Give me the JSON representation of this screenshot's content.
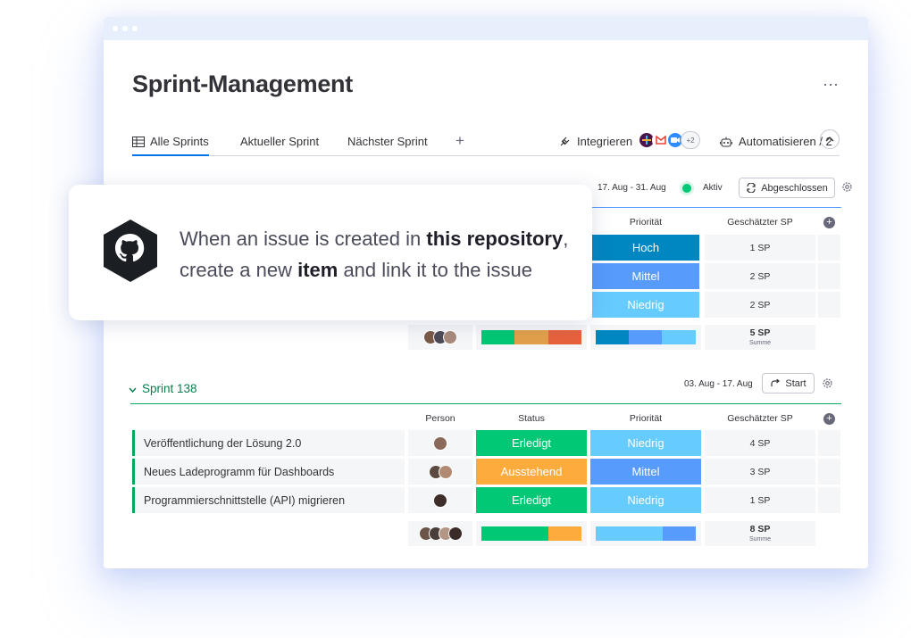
{
  "app": {
    "title": "Sprint-Management",
    "more_label": "⋯"
  },
  "tabs": [
    {
      "label": "Alle Sprints"
    },
    {
      "label": "Aktueller Sprint"
    },
    {
      "label": "Nächster Sprint"
    }
  ],
  "toolbar": {
    "add_tab": "+",
    "integrate_label": "Integrieren",
    "apps_more": "+2",
    "automate_label": "Automatisieren / 2"
  },
  "columns": {
    "person": "Person",
    "status": "Status",
    "priority": "Priorität",
    "estimate": "Geschätzter SP"
  },
  "group1": {
    "dates": "17. Aug - 31. Aug",
    "state": "Aktiv",
    "action": "Abgeschlossen",
    "rows": [
      {
        "priority": "Hoch",
        "priority_color": "#0086c0",
        "sp": "1 SP"
      },
      {
        "priority": "Mittel",
        "priority_color": "#579bfc",
        "sp": "2 SP"
      },
      {
        "priority": "Niedrig",
        "priority_color": "#66ccff",
        "sp": "2 SP"
      }
    ],
    "summary": {
      "sp": "5 SP",
      "sp_label": "Summe"
    }
  },
  "group2": {
    "title": "Sprint 138",
    "dates": "03. Aug - 17. Aug",
    "action": "Start",
    "rows": [
      {
        "name": "Veröffentlichung der Lösung 2.0",
        "status": "Erledigt",
        "status_color": "#00c875",
        "priority": "Niedrig",
        "priority_color": "#66ccff",
        "sp": "4 SP"
      },
      {
        "name": "Neues Ladeprogramm für Dashboards",
        "status": "Ausstehend",
        "status_color": "#fdab3d",
        "priority": "Mittel",
        "priority_color": "#579bfc",
        "sp": "3 SP"
      },
      {
        "name": "Programmierschnittstelle (API) migrieren",
        "status": "Erledigt",
        "status_color": "#00c875",
        "priority": "Niedrig",
        "priority_color": "#66ccff",
        "sp": "1 SP"
      }
    ],
    "summary": {
      "sp": "8 SP",
      "sp_label": "Summe"
    }
  },
  "card": {
    "line1_pre": "When an issue is created in ",
    "line1_bold": "this repository",
    "line1_post": ",",
    "line2_pre": "create a new ",
    "line2_bold": "item",
    "line2_post": " and link it to the issue",
    "logo_icon": "github-icon"
  },
  "colors": {
    "done": "#00c875",
    "pending": "#fdab3d",
    "stuck": "#e2445c",
    "high": "#0086c0",
    "medium": "#579bfc",
    "low": "#66ccff",
    "group2_accent": "#037f4c"
  }
}
